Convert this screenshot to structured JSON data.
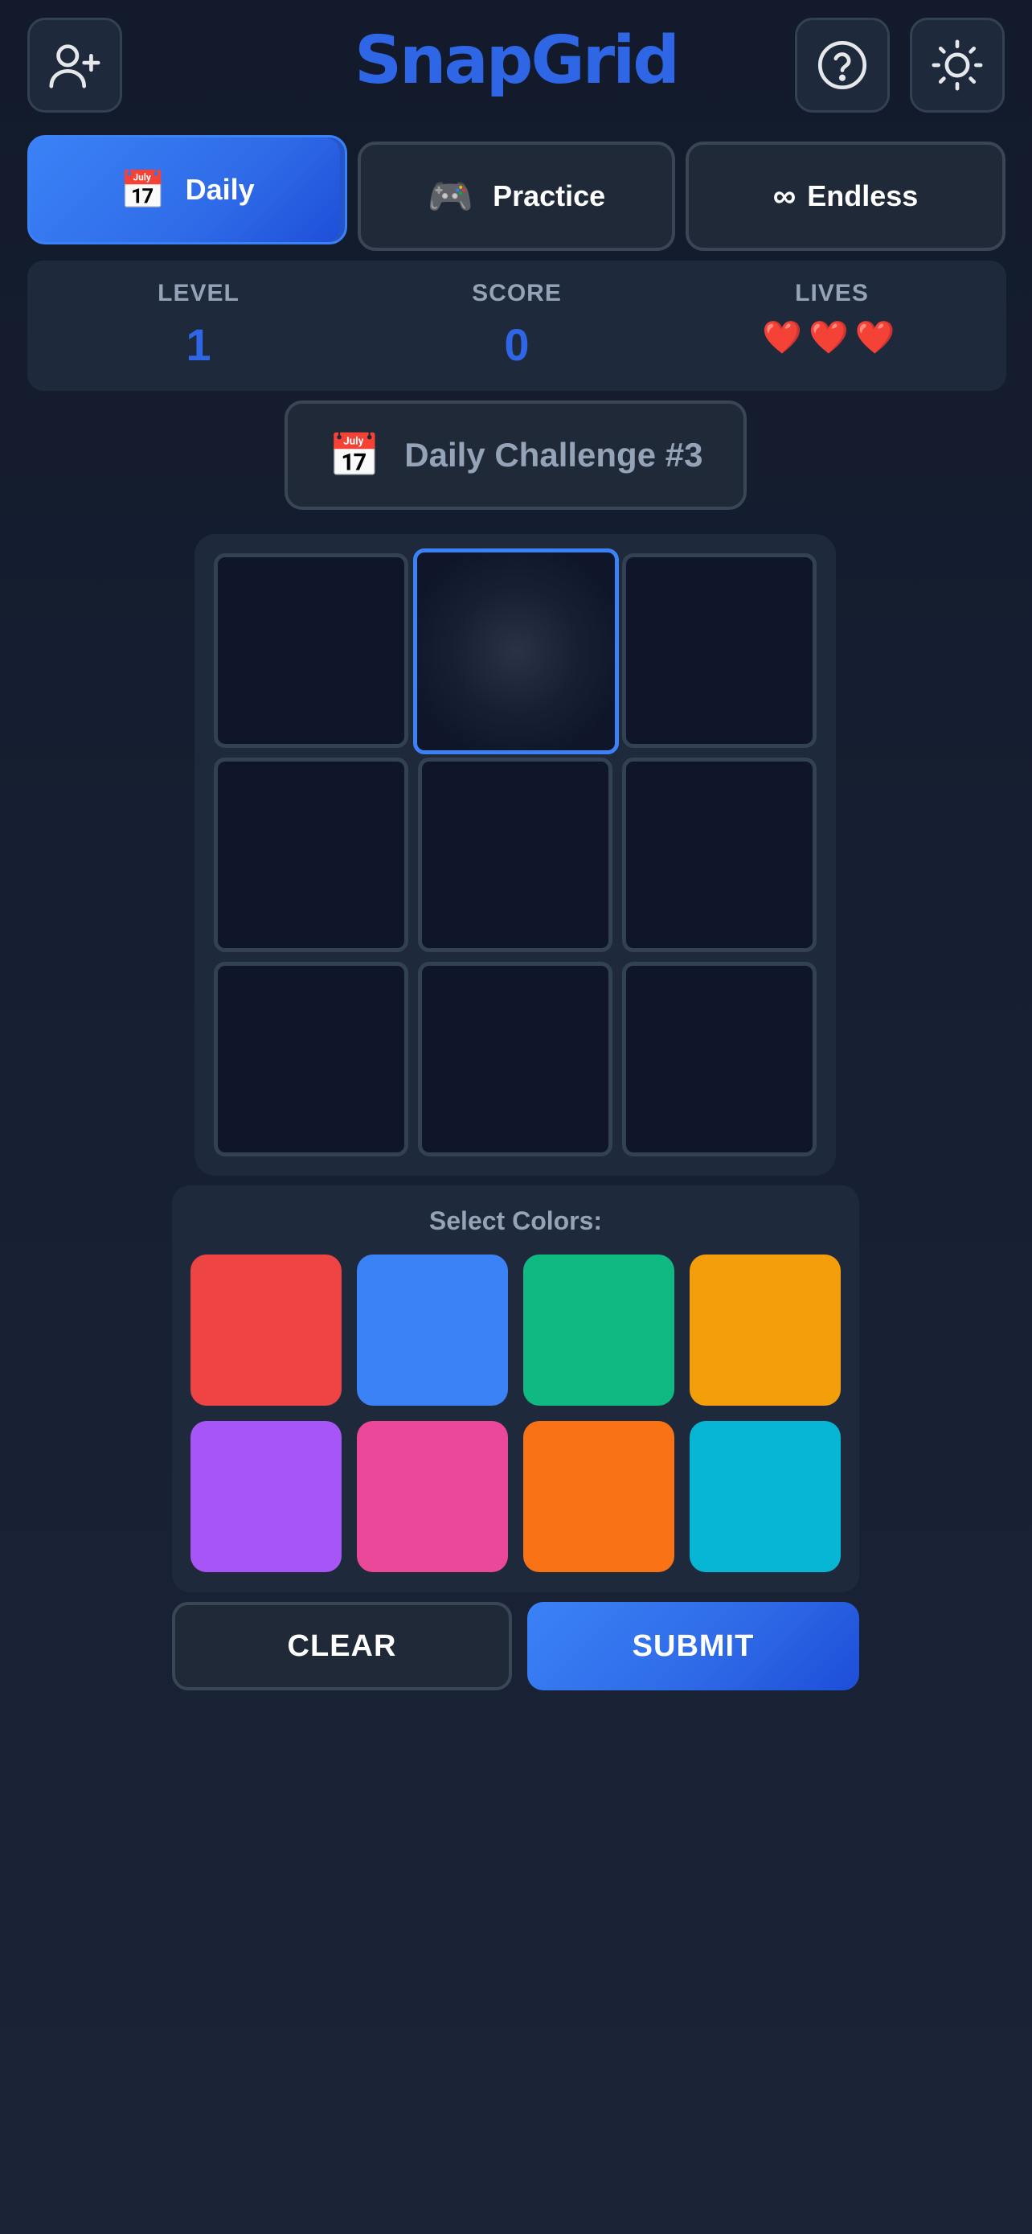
{
  "header": {
    "app_title": "SnapGrid",
    "add_user_icon": "add-user-icon",
    "help_icon": "help-icon",
    "theme_icon": "sun-icon"
  },
  "tabs": [
    {
      "emoji": "📅",
      "label": "Daily",
      "active": true
    },
    {
      "emoji": "🎮",
      "label": "Practice",
      "active": false
    },
    {
      "emoji": "∞",
      "label": "Endless",
      "active": false
    }
  ],
  "stats": {
    "level_label": "LEVEL",
    "level_value": "1",
    "score_label": "SCORE",
    "score_value": "0",
    "lives_label": "LIVES",
    "lives_value": "❤️❤️❤️"
  },
  "challenge": {
    "emoji": "📅",
    "label": "Daily Challenge #3"
  },
  "grid": {
    "rows": 3,
    "cols": 3,
    "selected_cell": 1
  },
  "palette": {
    "title": "Select Colors:",
    "colors": [
      "#ef4444",
      "#3b82f6",
      "#10b981",
      "#f59e0b",
      "#a855f7",
      "#ec4899",
      "#f97316",
      "#06b6d4"
    ]
  },
  "actions": {
    "clear_label": "CLEAR",
    "submit_label": "SUBMIT"
  },
  "theme": {
    "accent": "#3b82f6",
    "title_color": "#2f66e6"
  }
}
